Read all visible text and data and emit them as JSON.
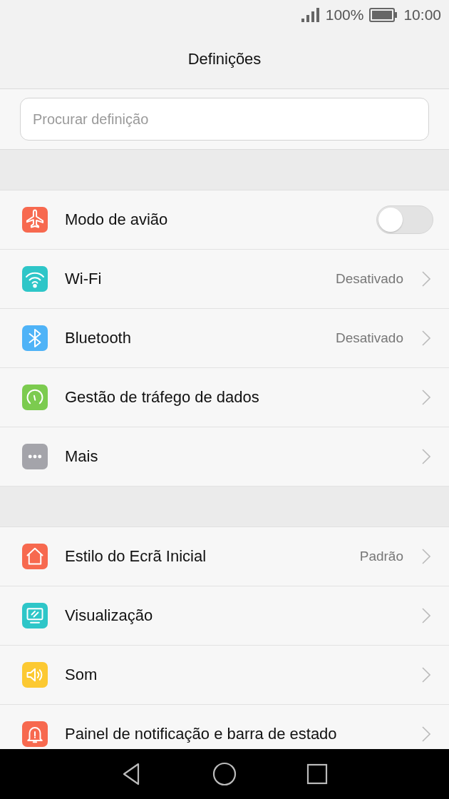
{
  "status_bar": {
    "battery_percent": "100%",
    "time": "10:00"
  },
  "title": "Definições",
  "search": {
    "placeholder": "Procurar definição"
  },
  "sections": [
    {
      "items": [
        {
          "label": "Modo de avião",
          "kind": "toggle",
          "on": false,
          "color": "#f7694f"
        },
        {
          "label": "Wi-Fi",
          "kind": "link",
          "value": "Desativado",
          "color": "#2ec6c8"
        },
        {
          "label": "Bluetooth",
          "kind": "link",
          "value": "Desativado",
          "color": "#4fb3f7"
        },
        {
          "label": "Gestão de tráfego de dados",
          "kind": "link",
          "color": "#7ccb4f"
        },
        {
          "label": "Mais",
          "kind": "link",
          "color": "#a4a4aa"
        }
      ]
    },
    {
      "items": [
        {
          "label": "Estilo do Ecrã Inicial",
          "kind": "link",
          "value": "Padrão",
          "color": "#f7694f"
        },
        {
          "label": "Visualização",
          "kind": "link",
          "color": "#2ec6c8"
        },
        {
          "label": "Som",
          "kind": "link",
          "color": "#fcc932"
        },
        {
          "label": "Painel de notificação e barra de estado",
          "kind": "link",
          "color": "#f7694f"
        }
      ]
    }
  ]
}
